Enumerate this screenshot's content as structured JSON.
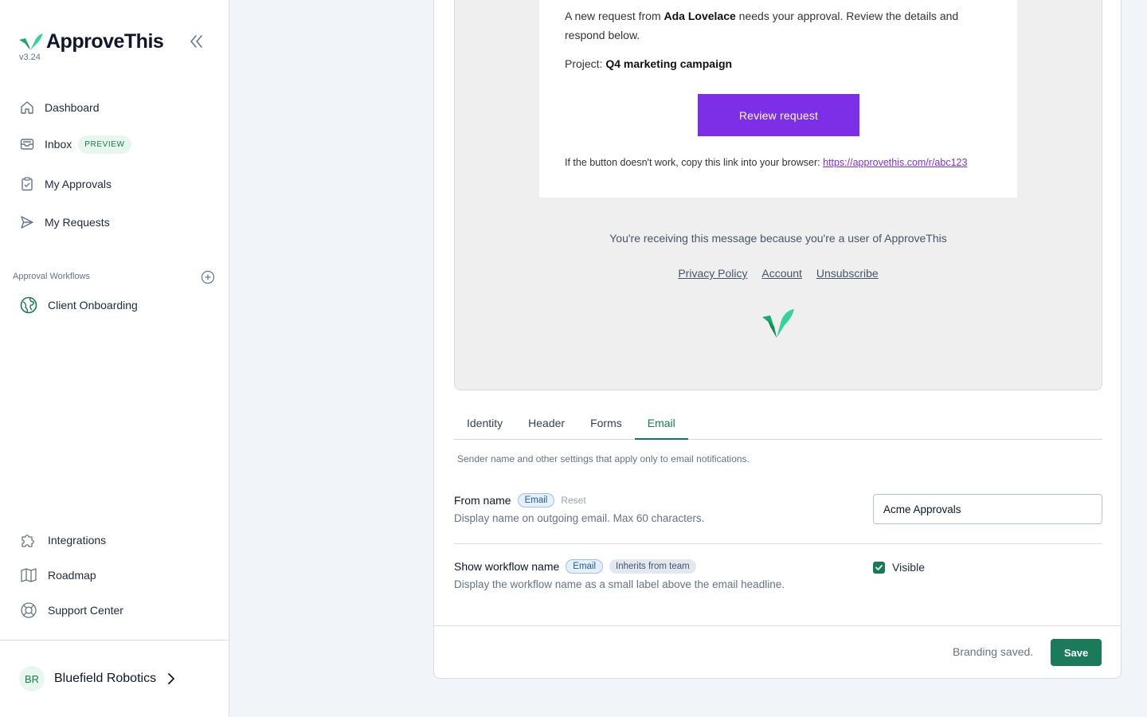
{
  "app": {
    "name": "ApproveThis",
    "version": "v3.24"
  },
  "sidebar": {
    "nav": [
      {
        "label": "Dashboard",
        "icon": "home-icon"
      },
      {
        "label": "Inbox",
        "icon": "inbox-icon",
        "badge": "PREVIEW"
      },
      {
        "label": "My Approvals",
        "icon": "clipboard-check-icon"
      },
      {
        "label": "My Requests",
        "icon": "send-icon"
      }
    ],
    "workflows_label": "Approval Workflows",
    "workflows": [
      {
        "label": "Client Onboarding",
        "icon": "globe-icon"
      }
    ],
    "bottom_nav": [
      {
        "label": "Integrations",
        "icon": "puzzle-icon"
      },
      {
        "label": "Roadmap",
        "icon": "map-icon"
      },
      {
        "label": "Support Center",
        "icon": "lifebuoy-icon"
      }
    ],
    "team": {
      "initials": "BR",
      "name": "Bluefield Robotics"
    }
  },
  "email_preview": {
    "intro_prefix": "A new request from ",
    "requester": "Ada Lovelace",
    "intro_suffix": " needs your approval. Review the details and respond below.",
    "project_label": "Project: ",
    "project_name": "Q4 marketing campaign",
    "button_label": "Review request",
    "fallback_text": "If the button doesn't work, copy this link into your browser: ",
    "fallback_link": "https://approvethis.com/r/abc123",
    "footer_message": "You're receiving this message because you're a user of ApproveThis",
    "footer_links": [
      "Privacy Policy",
      "Account",
      "Unsubscribe"
    ],
    "button_color": "#7c2fe6"
  },
  "tabs": {
    "items": [
      "Identity",
      "Header",
      "Forms",
      "Email"
    ],
    "active": "Email",
    "description": "Sender name and other settings that apply only to email notifications."
  },
  "settings": {
    "from_name": {
      "title": "From name",
      "chip": "Email",
      "reset": "Reset",
      "description": "Display name on outgoing email. Max 60 characters.",
      "value": "Acme Approvals"
    },
    "show_workflow": {
      "title": "Show workflow name",
      "chip": "Email",
      "inherit_chip": "Inherits from team",
      "description": "Display the workflow name as a small label above the email headline.",
      "checkbox_label": "Visible",
      "checked": true
    }
  },
  "footer": {
    "status": "Branding saved.",
    "save_label": "Save"
  },
  "colors": {
    "brand_green": "#167a52",
    "accent_purple": "#7c2fe6"
  }
}
